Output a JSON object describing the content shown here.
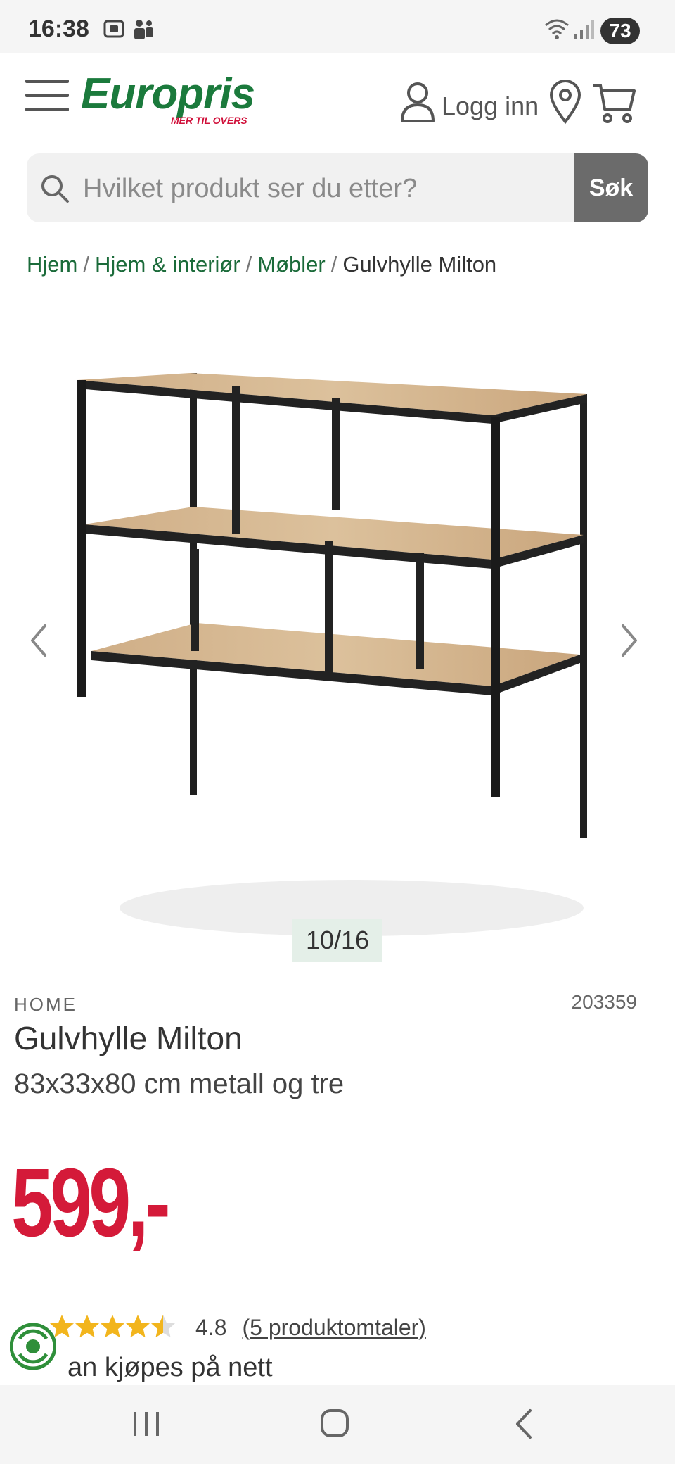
{
  "status_bar": {
    "time": "16:38",
    "battery": "73"
  },
  "header": {
    "logo_text": "Europris",
    "logo_tagline": "MER TIL OVERS",
    "login_label": "Logg inn",
    "brand_color": "#1b7a3c",
    "accent_color": "#d41a39"
  },
  "search": {
    "placeholder": "Hvilket produkt ser du etter?",
    "button_label": "Søk"
  },
  "breadcrumb": {
    "items": [
      "Hjem",
      "Hjem & interiør",
      "Møbler"
    ],
    "current": "Gulvhylle Milton",
    "separator": "/"
  },
  "gallery": {
    "counter": "10/16",
    "image_alt": "shelf-product-image"
  },
  "product": {
    "brand": "HOME",
    "sku": "203359",
    "title": "Gulvhylle Milton",
    "subtitle": "83x33x80 cm metall og tre",
    "price": "599,-",
    "rating_value": "4.8",
    "rating_stars": 4.5,
    "reviews_link": "(5 produktomtaler)",
    "availability": "an kjøpes på nett"
  }
}
